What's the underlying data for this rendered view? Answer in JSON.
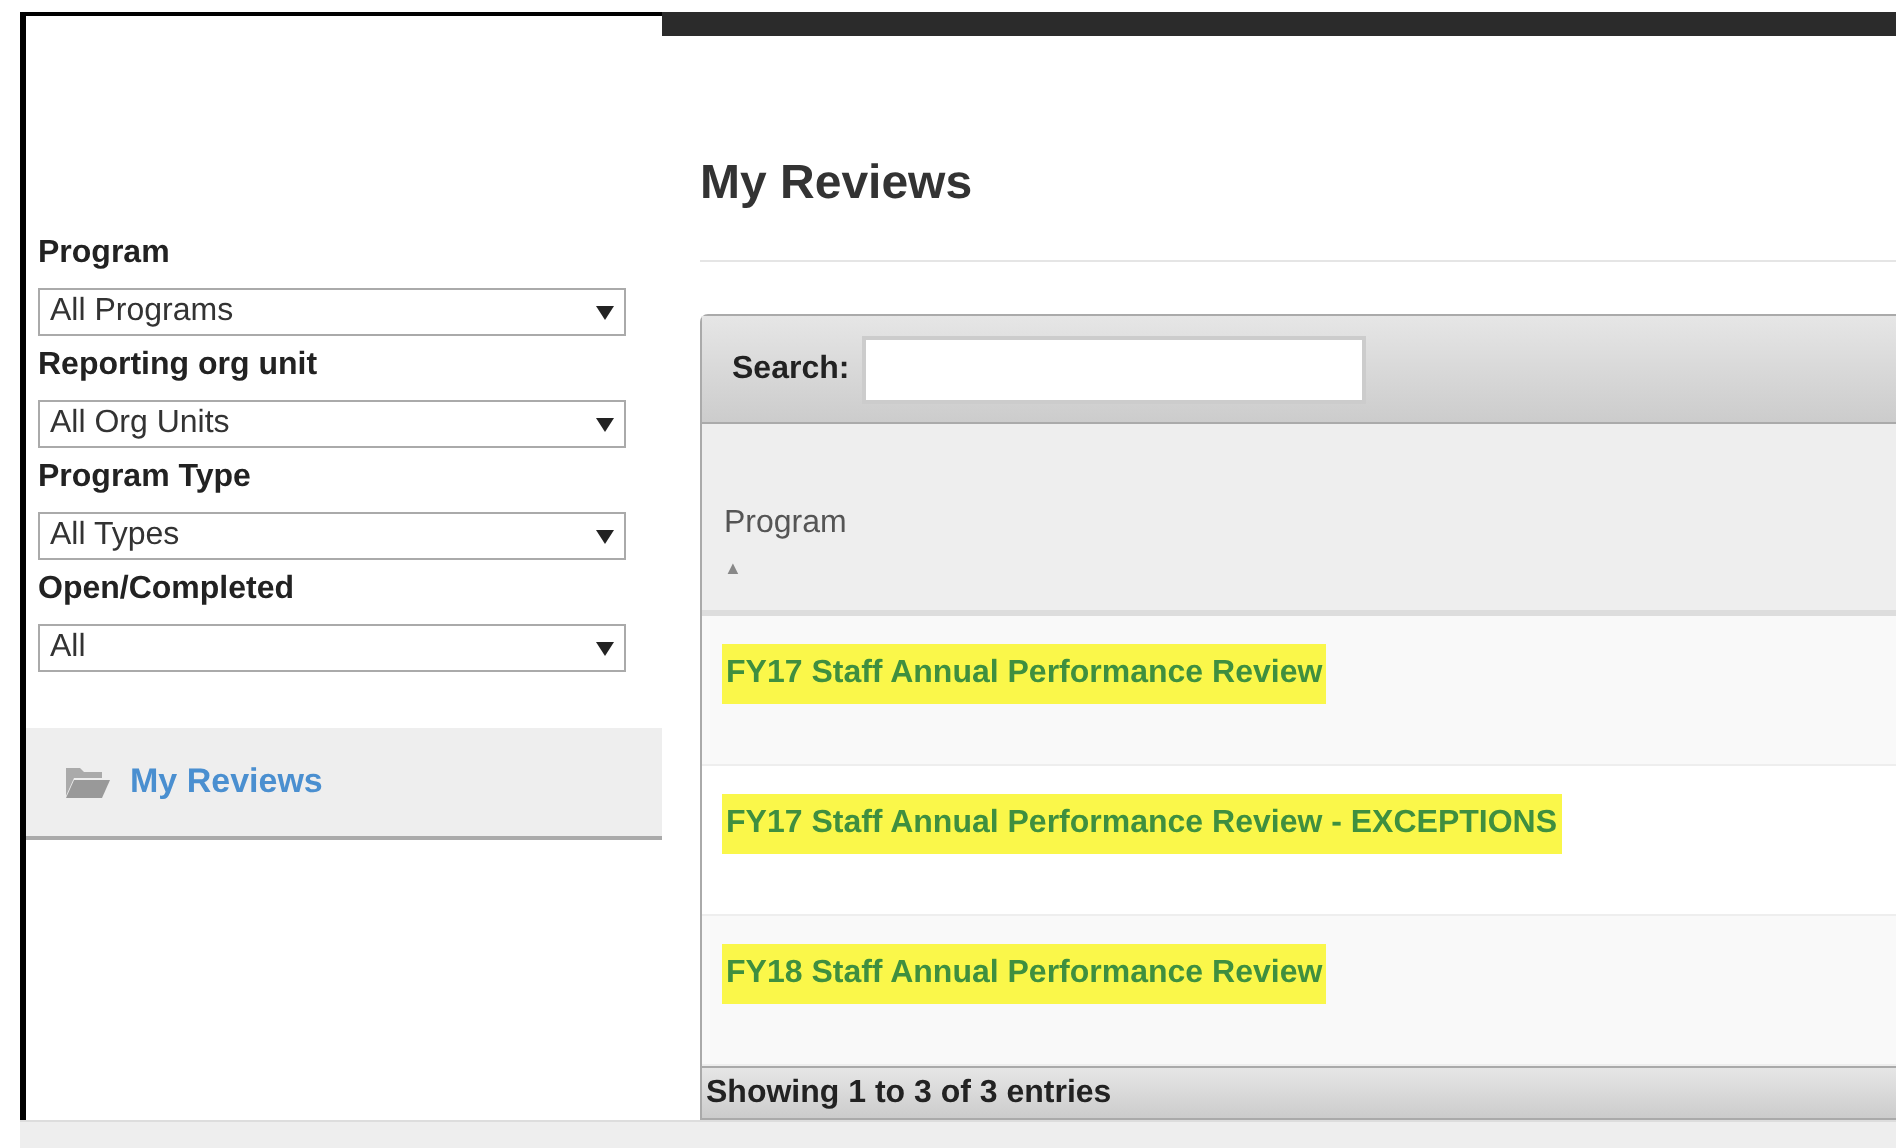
{
  "sidebar": {
    "filters": [
      {
        "label": "Program",
        "value": "All Programs"
      },
      {
        "label": "Reporting org unit",
        "value": "All Org Units"
      },
      {
        "label": "Program Type",
        "value": "All Types"
      },
      {
        "label": "Open/Completed",
        "value": "All"
      }
    ],
    "nav_items": [
      {
        "label": "My Reviews",
        "selected": true
      }
    ]
  },
  "main": {
    "title": "My Reviews",
    "search": {
      "label": "Search:"
    },
    "table": {
      "columns": [
        {
          "label": "Program",
          "sort_icon": "▲"
        }
      ],
      "rows": [
        {
          "program": "FY17 Staff Annual Performance Review",
          "highlighted": true
        },
        {
          "program": "FY17 Staff Annual Performance Review - EXCEPTIONS",
          "highlighted": true
        },
        {
          "program": "FY18 Staff Annual Performance Review",
          "highlighted": true
        }
      ],
      "info": "Showing 1 to 3 of 3 entries"
    }
  }
}
